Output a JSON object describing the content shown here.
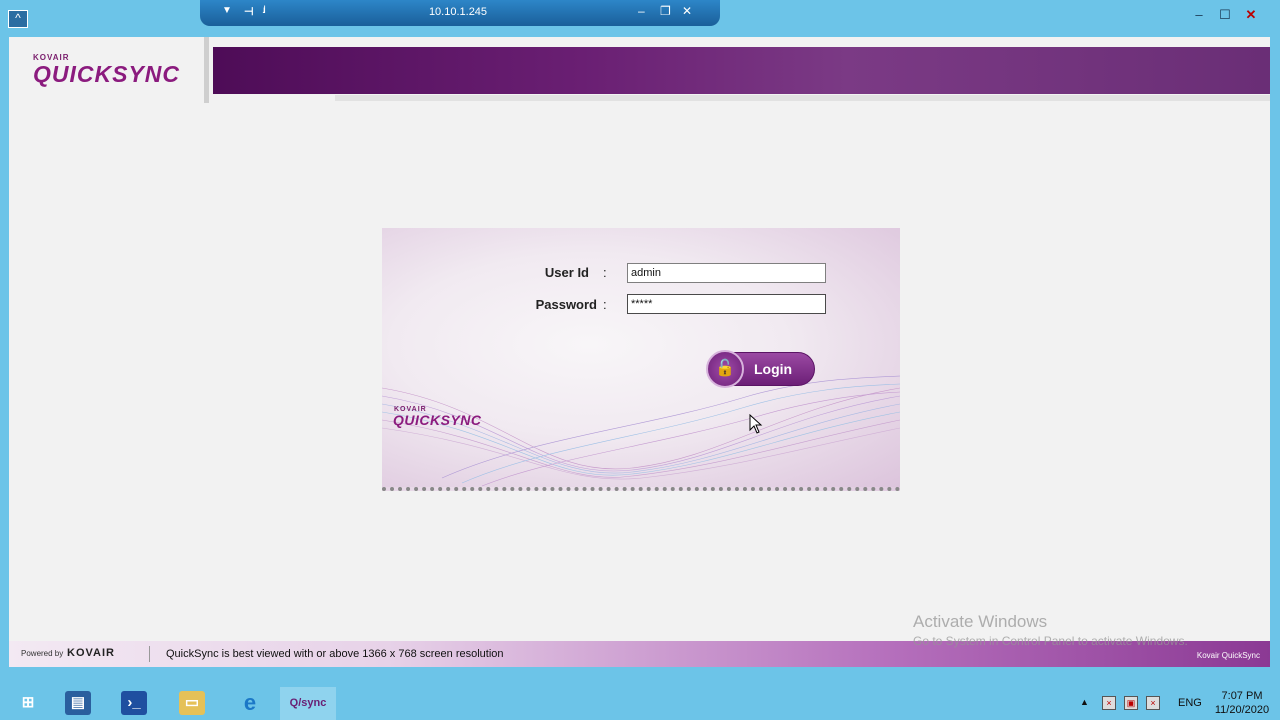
{
  "rdp": {
    "host": "10.10.1.245"
  },
  "window": {
    "minimize": "–",
    "maximize": "☐",
    "close": "✕"
  },
  "app": {
    "logo": {
      "small": "KOVAIR",
      "big": "QUICKSYNC"
    },
    "login": {
      "user_label": "User Id",
      "user_value": "admin",
      "password_label": "Password",
      "password_value": "*****",
      "colon": ":",
      "login_button": "Login"
    },
    "panel_logo": {
      "small": "KOVAIR",
      "big": "QUICKSYNC"
    },
    "footer": {
      "powered_by": "Powered by",
      "kovair": "KOVAIR",
      "note": "QuickSync is best viewed with or above 1366 x 768 screen resolution",
      "brand_right": "Kovair QuickSync"
    }
  },
  "activation": {
    "title": "Activate Windows",
    "subtitle": "Go to System in Control Panel to activate Windows."
  },
  "taskbar": {
    "language": "ENG",
    "time": "7:07 PM",
    "date": "11/20/2020",
    "qsync_label": "Q/sync"
  },
  "colors": {
    "accent": "#6a1f73",
    "taskbar": "#6cc4e8"
  }
}
